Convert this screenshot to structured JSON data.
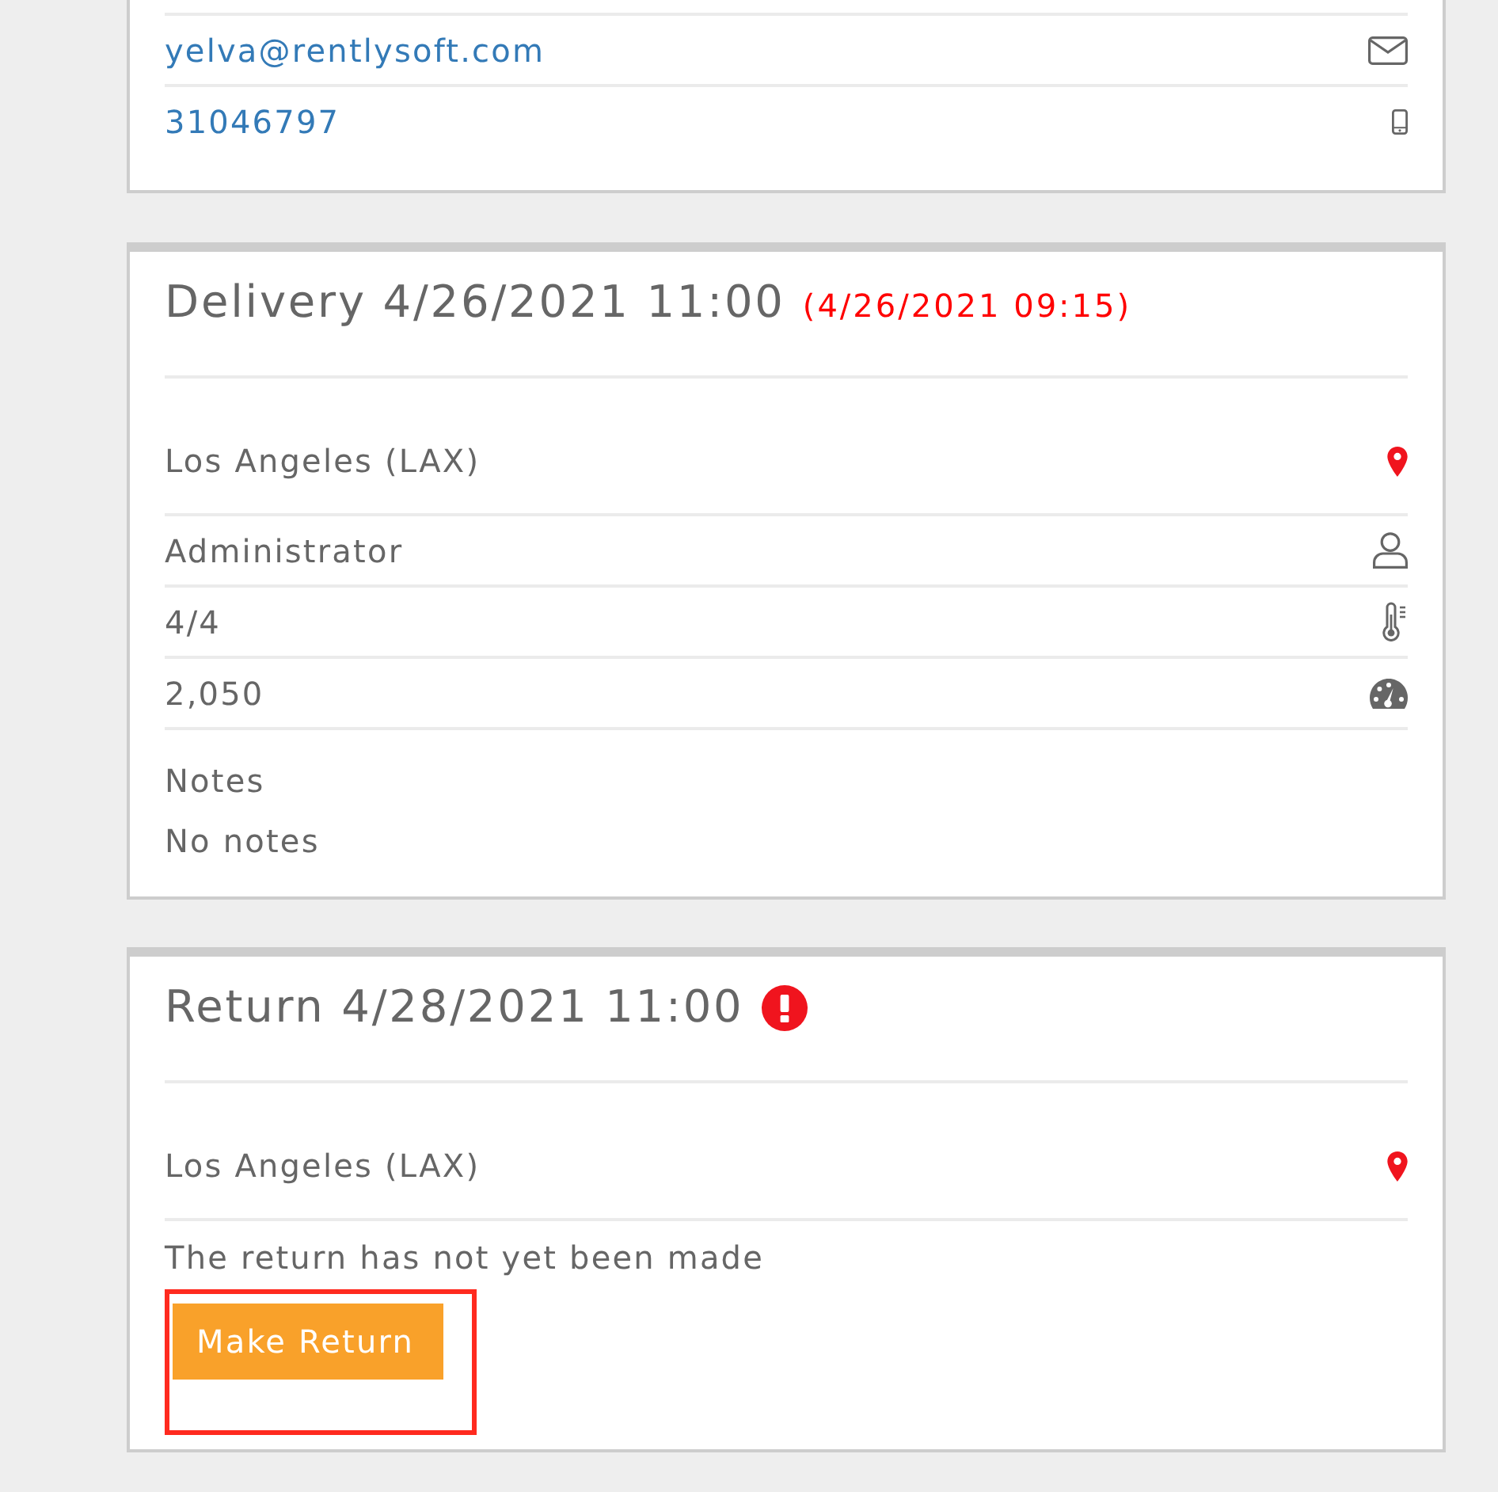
{
  "contact": {
    "rows": [
      {
        "kind": "email",
        "text": "yelva@rentlysoft.com"
      },
      {
        "kind": "phone",
        "text": "31046797"
      }
    ]
  },
  "delivery": {
    "title": "Delivery 4/26/2021 11:00",
    "actual_time": "(4/26/2021 09:15)",
    "rows": [
      {
        "kind": "location",
        "text": "Los Angeles (LAX)"
      },
      {
        "kind": "user",
        "text": "Administrator"
      },
      {
        "kind": "thermometer",
        "text": "4/4"
      },
      {
        "kind": "gauge",
        "text": "2,050"
      }
    ],
    "notes_label": "Notes",
    "notes": "No notes"
  },
  "return": {
    "title": "Return 4/28/2021 11:00",
    "warning": true,
    "rows": [
      {
        "kind": "location",
        "text": "Los Angeles (LAX)"
      }
    ],
    "status": "The return has not yet been made",
    "button": {
      "label": "Make Return",
      "highlighted": true
    }
  }
}
